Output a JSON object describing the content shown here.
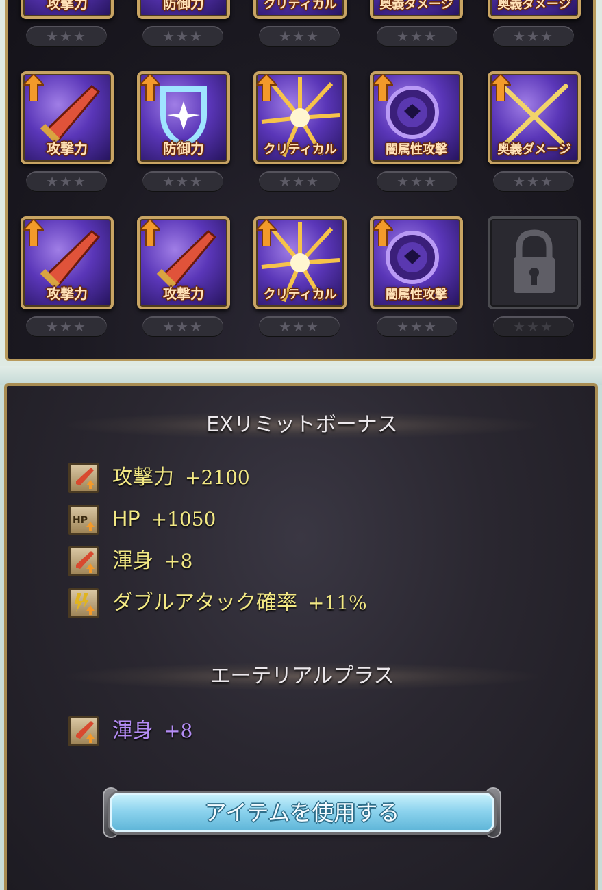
{
  "grid": {
    "row0": [
      {
        "label": "攻撃力",
        "stars": "★★★"
      },
      {
        "label": "防御力",
        "stars": "★★★"
      },
      {
        "label": "クリティカル",
        "stars": "★★★"
      },
      {
        "label": "奥義ダメージ",
        "stars": "★★★"
      },
      {
        "label": "奥義ダメージ",
        "stars": "★★★"
      }
    ],
    "row1": [
      {
        "label": "攻撃力",
        "icon": "sword-icon",
        "stars": "★★★"
      },
      {
        "label": "防御力",
        "icon": "shield-icon",
        "stars": "★★★"
      },
      {
        "label": "クリティカル",
        "icon": "lightning-icon",
        "stars": "★★★"
      },
      {
        "label": "闇属性攻撃",
        "icon": "dark-orb-icon",
        "stars": "★★★"
      },
      {
        "label": "奥義ダメージ",
        "icon": "crossed-swords-icon",
        "stars": "★★★"
      }
    ],
    "row2": [
      {
        "label": "攻撃力",
        "icon": "sword-icon",
        "stars": "★★★"
      },
      {
        "label": "攻撃力",
        "icon": "sword-icon",
        "stars": "★★★"
      },
      {
        "label": "クリティカル",
        "icon": "lightning-icon",
        "stars": "★★★"
      },
      {
        "label": "闇属性攻撃",
        "icon": "dark-orb-icon",
        "stars": "★★★"
      },
      {
        "label": "",
        "icon": "lock-icon",
        "stars": "★★★"
      }
    ]
  },
  "ex_limit": {
    "title": "EXリミットボーナス",
    "items": [
      {
        "name": "攻撃力",
        "value": "+2100",
        "icon": "sword-up-icon"
      },
      {
        "name": "HP",
        "value": "+1050",
        "icon": "hp-up-icon"
      },
      {
        "name": "渾身",
        "value": "+8",
        "icon": "sword-up-icon"
      },
      {
        "name": "ダブルアタック確率",
        "value": "+11%",
        "icon": "double-attack-up-icon"
      }
    ]
  },
  "ethereal": {
    "title": "エーテリアルプラス",
    "items": [
      {
        "name": "渾身",
        "value": "+8",
        "icon": "sword-up-icon"
      }
    ]
  },
  "use_item_button": "アイテムを使用する",
  "colors": {
    "gold_frame": "#c8a463",
    "bonus_text": "#f2e884",
    "ethereal_text": "#b48cf5",
    "button": "#8dd3ee"
  }
}
